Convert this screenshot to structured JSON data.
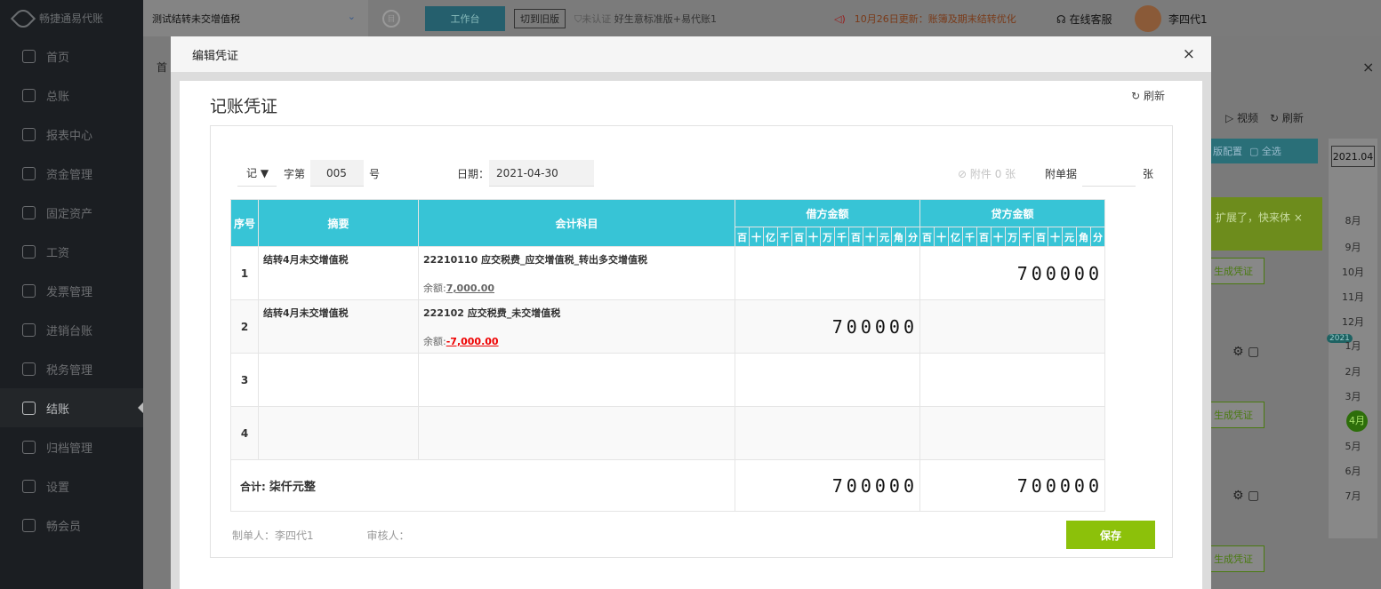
{
  "app": {
    "name": "畅捷通易代账"
  },
  "topbar": {
    "company": "测试结转未交增值税",
    "workbench": "工作台",
    "switch_old": "切到旧版",
    "cert_status": "未认证",
    "plan": "好生意标准版+易代账1",
    "notice": "10月26日更新：账簿及期末结转优化",
    "service": "在线客服",
    "user": "李四代1"
  },
  "sidebar": {
    "items": [
      {
        "label": "首页",
        "icon": "home-icon"
      },
      {
        "label": "总账",
        "icon": "ledger-icon"
      },
      {
        "label": "报表中心",
        "icon": "chart-icon"
      },
      {
        "label": "资金管理",
        "icon": "fund-icon"
      },
      {
        "label": "固定资产",
        "icon": "asset-icon"
      },
      {
        "label": "工资",
        "icon": "salary-icon"
      },
      {
        "label": "发票管理",
        "icon": "invoice-icon"
      },
      {
        "label": "进销台账",
        "icon": "trade-icon"
      },
      {
        "label": "税务管理",
        "icon": "tax-icon"
      },
      {
        "label": "结账",
        "icon": "close-book-icon",
        "active": true
      },
      {
        "label": "归档管理",
        "icon": "archive-icon"
      },
      {
        "label": "设置",
        "icon": "gear-icon"
      },
      {
        "label": "畅会员",
        "icon": "vip-icon"
      }
    ]
  },
  "background": {
    "tab_first": "首",
    "video": "视频",
    "refresh": "刷新",
    "config": "版配置",
    "select_all": "全选",
    "toast": "扩展了，快来体",
    "gen_voucher": "生成凭证",
    "year": "2021.04",
    "year_badge": "2021",
    "months": [
      "8月",
      "9月",
      "10月",
      "11月",
      "12月",
      "1月",
      "2月",
      "3月",
      "4月",
      "5月",
      "6月",
      "7月"
    ]
  },
  "modal": {
    "title": "编辑凭证",
    "voucher_title": "记账凭证",
    "refresh": "刷新",
    "word": "记",
    "zi_di": "字第",
    "number": "005",
    "hao": "号",
    "date_label": "日期：",
    "date": "2021-04-30",
    "attachment": "附件 0 张",
    "attach_doc_label": "附单据",
    "attach_unit": "张",
    "headers": {
      "seq": "序号",
      "summary": "摘要",
      "subject": "会计科目",
      "debit": "借方金额",
      "credit": "贷方金额"
    },
    "digit_labels": [
      "百",
      "十",
      "亿",
      "千",
      "百",
      "十",
      "万",
      "千",
      "百",
      "十",
      "元",
      "角",
      "分"
    ],
    "rows": [
      {
        "seq": "1",
        "summary": "结转4月未交增值税",
        "subject": "22210110 应交税费_应交增值税_转出多交增值税",
        "balance_label": "余额:",
        "balance": "7,000.00",
        "debit": "",
        "credit": "700000"
      },
      {
        "seq": "2",
        "summary": "结转4月未交增值税",
        "subject": "222102 应交税费_未交增值税",
        "balance_label": "余额:",
        "balance": "-7,000.00",
        "debit": "700000",
        "credit": ""
      },
      {
        "seq": "3",
        "summary": "",
        "subject": "",
        "balance_label": "",
        "balance": "",
        "debit": "",
        "credit": ""
      },
      {
        "seq": "4",
        "summary": "",
        "subject": "",
        "balance_label": "",
        "balance": "",
        "debit": "",
        "credit": ""
      }
    ],
    "total_label": "合计:",
    "total_words": "柒仟元整",
    "total_debit": "700000",
    "total_credit": "700000",
    "maker": "制单人：李四代1",
    "reviewer": "审核人：",
    "save": "保存"
  }
}
